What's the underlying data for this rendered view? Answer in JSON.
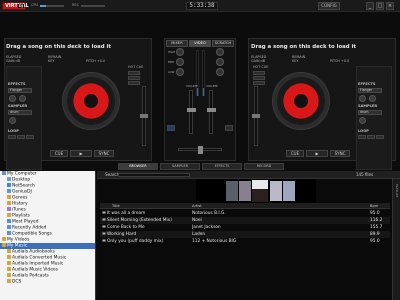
{
  "topbar": {
    "logo_main": "VIRTUAL",
    "logo_badge": "DJ",
    "meter_labels": [
      "CPU",
      "REC"
    ],
    "clock": "5:33:38",
    "config_label": "CONFIG",
    "window_buttons": [
      "_",
      "□",
      "×"
    ]
  },
  "decks": {
    "left": {
      "title": "Drag a song on this deck to load it",
      "labels": {
        "elapsed": "ELAPSED",
        "gain": "GAIN dB",
        "remain": "REMAIN",
        "key": "KEY",
        "pitch": "PITCH +0.0"
      },
      "effects_label": "EFFECTS",
      "effect_value": "Flanger",
      "sampler_label": "SAMPLER",
      "sampler_value": "drum",
      "loop_label": "LOOP",
      "transport": [
        "CUE",
        "▶",
        "SYNC"
      ],
      "side_labels": [
        "HOT CUE",
        "PITCH"
      ]
    },
    "right": {
      "title": "Drag a song on this deck to load it",
      "labels": {
        "elapsed": "ELAPSED",
        "gain": "GAIN dB",
        "remain": "REMAIN",
        "key": "KEY",
        "pitch": "PITCH +0.0"
      },
      "effects_label": "EFFECTS",
      "effect_value": "Flanger",
      "sampler_label": "SAMPLER",
      "sampler_value": "drum",
      "loop_label": "LOOP",
      "transport": [
        "CUE",
        "▶",
        "SYNC"
      ],
      "side_labels": [
        "HOT CUE",
        "PITCH"
      ]
    }
  },
  "mixer": {
    "tabs": [
      "MIXER",
      "VIDEO",
      "SCRATCH"
    ],
    "active_tab": "VIDEO",
    "eq_labels": [
      "HIGH",
      "MED",
      "LOW"
    ],
    "volume_labels": [
      "VOLUME",
      "VOLUME"
    ],
    "fader_levels": {
      "left_volume": 0.55,
      "right_volume": 0.55,
      "crossfader": 0.5
    }
  },
  "browser_tabs": [
    "BROWSER",
    "SAMPLER",
    "EFFECTS",
    "RECORD"
  ],
  "active_browser_tab": "BROWSER",
  "tree": {
    "items": [
      {
        "label": "My Computer",
        "indent": 0,
        "color": "#6a8fbf"
      },
      {
        "label": "Desktop",
        "indent": 1,
        "color": "#7a9cc7"
      },
      {
        "label": "NetSearch",
        "indent": 1,
        "color": "#3f86d6"
      },
      {
        "label": "GeniusDJ",
        "indent": 1,
        "color": "#4aa0d8"
      },
      {
        "label": "Genres",
        "indent": 1,
        "color": "#d6a540"
      },
      {
        "label": "History",
        "indent": 1,
        "color": "#d6a540"
      },
      {
        "label": "iTunes",
        "indent": 1,
        "color": "#9a7ad0"
      },
      {
        "label": "Playlists",
        "indent": 1,
        "color": "#d6a540"
      },
      {
        "label": "Most Played",
        "indent": 1,
        "color": "#5a8fd0"
      },
      {
        "label": "Recently Added",
        "indent": 1,
        "color": "#5a8fd0"
      },
      {
        "label": "Compatible Songs",
        "indent": 1,
        "color": "#5a8fd0"
      },
      {
        "label": "My Videos",
        "indent": 0,
        "color": "#d6a540"
      },
      {
        "label": "My Music",
        "indent": 0,
        "color": "#d6a540",
        "selected": true
      },
      {
        "label": "Audials Audiobooks",
        "indent": 1,
        "color": "#d6a540"
      },
      {
        "label": "Audials Converted Music",
        "indent": 1,
        "color": "#d6a540"
      },
      {
        "label": "Audials Imported Music",
        "indent": 1,
        "color": "#d6a540"
      },
      {
        "label": "Audials Music Videos",
        "indent": 1,
        "color": "#d6a540"
      },
      {
        "label": "Audials Podcasts",
        "indent": 1,
        "color": "#d6a540"
      },
      {
        "label": "DCS",
        "indent": 1,
        "color": "#d6a540"
      }
    ]
  },
  "search": {
    "label": "Search",
    "value": ""
  },
  "files_count": "145 files",
  "columns": [
    "Title",
    "Artist",
    "Bpm"
  ],
  "tracks": [
    {
      "title": "It was all a dream",
      "artist": "Notorious B.I.G.",
      "bpm": "95.0"
    },
    {
      "title": "Silent Morning (Extended Mix)",
      "artist": "Noel",
      "bpm": "116.2"
    },
    {
      "title": "Come Back to Me",
      "artist": "Janet Jackson",
      "bpm": "155.7"
    },
    {
      "title": "Working Hard",
      "artist": "Laden",
      "bpm": "89.9"
    },
    {
      "title": "Only you (puff daddy mix)",
      "artist": "112 + Notorious BIG",
      "bpm": "95.0"
    }
  ],
  "playlist_strip_label": "PLAYLIST",
  "colors": {
    "accent_red": "#d81818",
    "selection_blue": "#3d6fb8"
  }
}
